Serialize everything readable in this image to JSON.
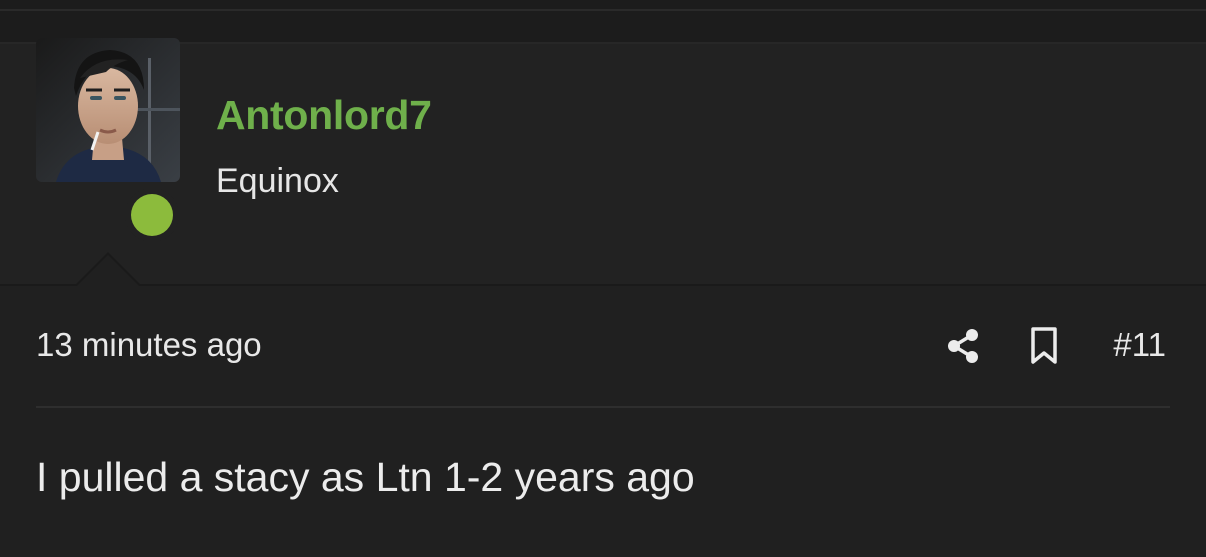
{
  "user": {
    "username": "Antonlord7",
    "title": "Equinox",
    "online": true,
    "username_color": "#6fb04b",
    "online_color": "#8cbb3c"
  },
  "post": {
    "timestamp": "13 minutes ago",
    "number": "#11",
    "body": "I pulled a stacy as Ltn 1-2 years ago"
  },
  "actions": {
    "share_icon": "share-icon",
    "bookmark_icon": "bookmark-icon"
  }
}
